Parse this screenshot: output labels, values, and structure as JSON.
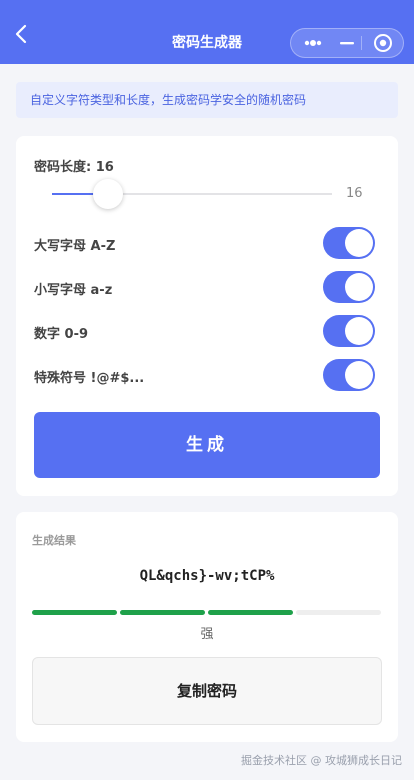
{
  "navbar": {
    "title": "密码生成器",
    "back_icon": "chevron-left-icon",
    "more_icon": "more-dots-icon",
    "minimize_icon": "minimize-icon",
    "close_icon": "target-circle-icon",
    "color": "#5670f2"
  },
  "banner": {
    "text": "自定义字符类型和长度，生成密码学安全的随机密码"
  },
  "settings": {
    "length_label": "密码长度: 16",
    "length_value": "16",
    "length": 16,
    "length_min": 4,
    "length_max": 64,
    "options": [
      {
        "label": "大写字母 A-Z",
        "enabled": true
      },
      {
        "label": "小写字母 a-z",
        "enabled": true
      },
      {
        "label": "数字 0-9",
        "enabled": true
      },
      {
        "label": "特殊符号 !@#$...",
        "enabled": true
      }
    ],
    "generate_label": "生成"
  },
  "result": {
    "label": "生成结果",
    "password": "QL&qchs}-wv;tCP%",
    "strength_segments": [
      true,
      true,
      true,
      false
    ],
    "strength_color": "#1fa14a",
    "strength_text": "强",
    "copy_label": "复制密码"
  },
  "watermark": "掘金技术社区 @ 攻城狮成长日记"
}
